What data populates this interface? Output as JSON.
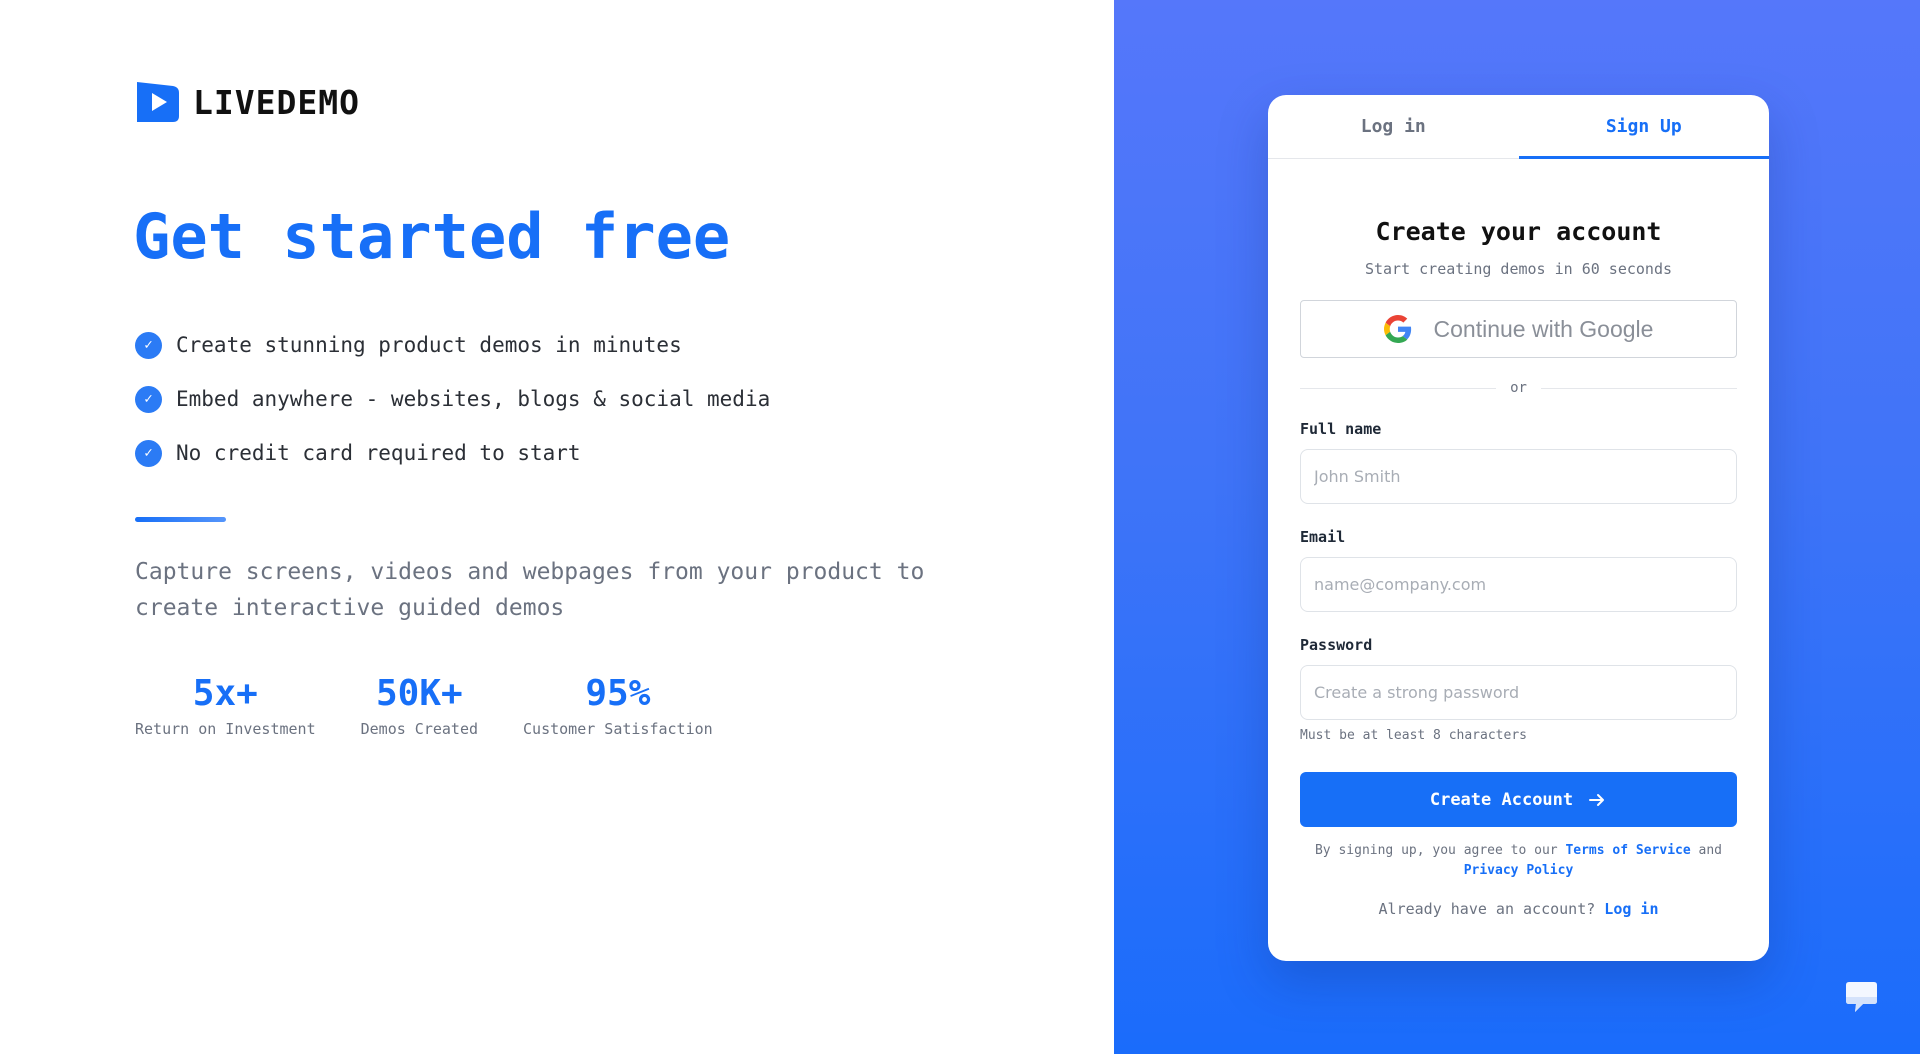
{
  "brand": {
    "name": "LIVEDEMO",
    "accent_color": "#176ff7",
    "logo_icon": "play-flag-icon"
  },
  "hero": {
    "headline": "Get started free",
    "features": [
      {
        "icon": "check-circle-icon",
        "text": "Create stunning product demos in minutes"
      },
      {
        "icon": "check-circle-icon",
        "text": "Embed anywhere - websites, blogs & social media"
      },
      {
        "icon": "check-circle-icon",
        "text": "No credit card required to start"
      }
    ],
    "description": "Capture screens, videos and webpages from your product to create interactive guided demos",
    "stats": [
      {
        "value": "5x+",
        "label": "Return on Investment"
      },
      {
        "value": "50K+",
        "label": "Demos Created"
      },
      {
        "value": "95%",
        "label": "Customer Satisfaction"
      }
    ]
  },
  "auth_card": {
    "tabs": [
      {
        "label": "Log in",
        "active": false
      },
      {
        "label": "Sign Up",
        "active": true
      }
    ],
    "title": "Create your account",
    "subtitle": "Start creating demos in 60 seconds",
    "google_button": {
      "label": "Continue with Google",
      "icon": "google-icon"
    },
    "divider_text": "or",
    "fields": {
      "full_name": {
        "label": "Full name",
        "placeholder": "John Smith",
        "value": ""
      },
      "email": {
        "label": "Email",
        "placeholder": "name@company.com",
        "value": ""
      },
      "password": {
        "label": "Password",
        "placeholder": "Create a strong password",
        "value": "",
        "help": "Must be at least 8 characters"
      }
    },
    "submit": {
      "label": "Create Account",
      "icon": "arrow-right-icon"
    },
    "legal": {
      "prefix": "By signing up, you agree to our",
      "terms": "Terms of Service",
      "conjunction": "and",
      "privacy": "Privacy Policy"
    },
    "switch": {
      "prompt": "Already have an account?",
      "link": "Log in"
    }
  },
  "chat_widget": {
    "icon": "chat-bubble-icon"
  }
}
